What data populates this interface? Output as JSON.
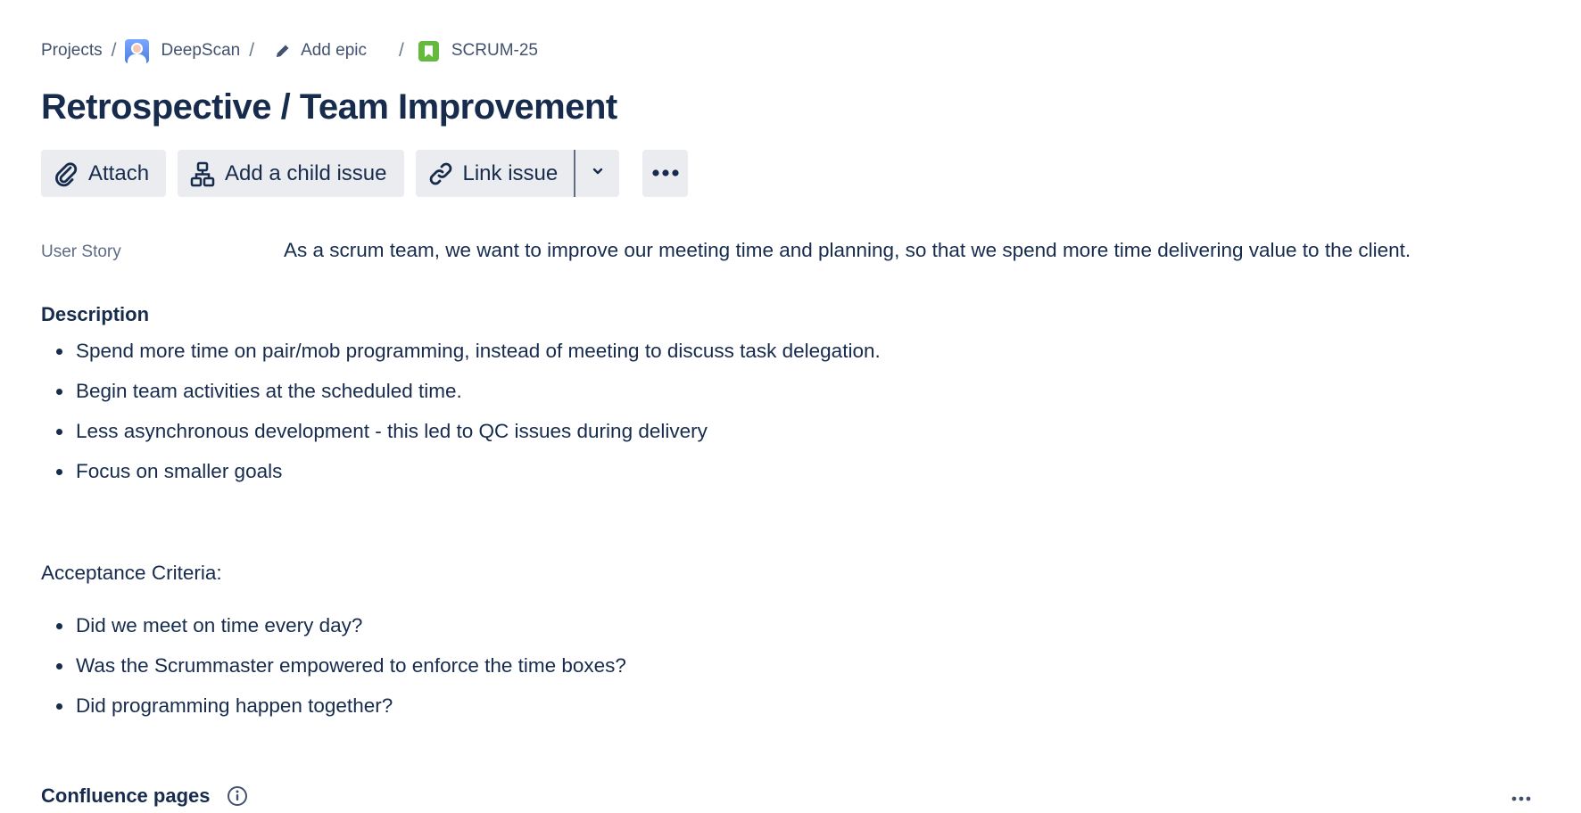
{
  "breadcrumb": {
    "projects": "Projects",
    "project": "DeepScan",
    "epic": "Add epic",
    "issue_key": "SCRUM-25",
    "separator": "/"
  },
  "issue": {
    "title": "Retrospective / Team Improvement"
  },
  "toolbar": {
    "attach": "Attach",
    "add_child": "Add a child issue",
    "link_issue": "Link issue"
  },
  "fields": {
    "user_story_label": "User Story",
    "user_story_value": "As a scrum team, we want to improve our meeting time and planning, so that we spend more time delivering value to the client."
  },
  "description": {
    "heading": "Description",
    "items": [
      "Spend more time on pair/mob programming, instead of meeting to discuss task delegation.",
      "Begin team activities at the scheduled time.",
      "Less asynchronous development - this led to QC issues during delivery",
      "Focus on smaller goals"
    ],
    "acceptance_label": "Acceptance Criteria:",
    "criteria": [
      "Did we meet on time every day?",
      "Was the Scrummaster empowered to enforce the time boxes?",
      "Did programming happen together?"
    ]
  },
  "confluence": {
    "heading": "Confluence pages"
  },
  "colors": {
    "text": "#172b4d",
    "subtle": "#42526e",
    "button_bg": "#ebecf0",
    "story_green": "#63ba3c"
  },
  "icons": {
    "attach": "paperclip-icon",
    "child": "hierarchy-icon",
    "link": "link-icon",
    "chevron": "chevron-down-icon",
    "more": "more-icon",
    "info": "info-icon",
    "edit": "pencil-icon",
    "story": "story-icon"
  }
}
